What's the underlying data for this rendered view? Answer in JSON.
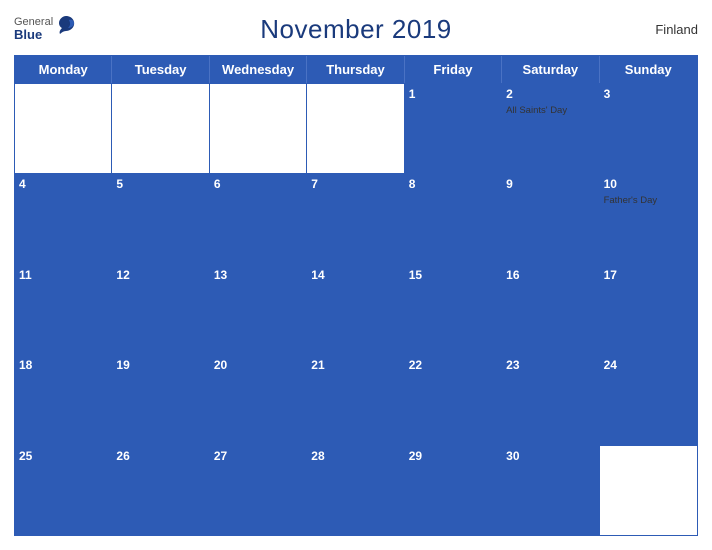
{
  "header": {
    "title": "November 2019",
    "country": "Finland",
    "logo": {
      "general": "General",
      "blue": "Blue"
    }
  },
  "days_of_week": [
    "Monday",
    "Tuesday",
    "Wednesday",
    "Thursday",
    "Friday",
    "Saturday",
    "Sunday"
  ],
  "weeks": [
    [
      {
        "day": "",
        "event": ""
      },
      {
        "day": "",
        "event": ""
      },
      {
        "day": "",
        "event": ""
      },
      {
        "day": "",
        "event": ""
      },
      {
        "day": "1",
        "event": ""
      },
      {
        "day": "2",
        "event": "All Saints' Day"
      },
      {
        "day": "3",
        "event": ""
      }
    ],
    [
      {
        "day": "4",
        "event": ""
      },
      {
        "day": "5",
        "event": ""
      },
      {
        "day": "6",
        "event": ""
      },
      {
        "day": "7",
        "event": ""
      },
      {
        "day": "8",
        "event": ""
      },
      {
        "day": "9",
        "event": ""
      },
      {
        "day": "10",
        "event": "Father's Day"
      }
    ],
    [
      {
        "day": "11",
        "event": ""
      },
      {
        "day": "12",
        "event": ""
      },
      {
        "day": "13",
        "event": ""
      },
      {
        "day": "14",
        "event": ""
      },
      {
        "day": "15",
        "event": ""
      },
      {
        "day": "16",
        "event": ""
      },
      {
        "day": "17",
        "event": ""
      }
    ],
    [
      {
        "day": "18",
        "event": ""
      },
      {
        "day": "19",
        "event": ""
      },
      {
        "day": "20",
        "event": ""
      },
      {
        "day": "21",
        "event": ""
      },
      {
        "day": "22",
        "event": ""
      },
      {
        "day": "23",
        "event": ""
      },
      {
        "day": "24",
        "event": ""
      }
    ],
    [
      {
        "day": "25",
        "event": ""
      },
      {
        "day": "26",
        "event": ""
      },
      {
        "day": "27",
        "event": ""
      },
      {
        "day": "28",
        "event": ""
      },
      {
        "day": "29",
        "event": ""
      },
      {
        "day": "30",
        "event": ""
      },
      {
        "day": "",
        "event": ""
      }
    ]
  ],
  "colors": {
    "header_blue": "#2d5bb5",
    "title_blue": "#1a3a7c"
  }
}
